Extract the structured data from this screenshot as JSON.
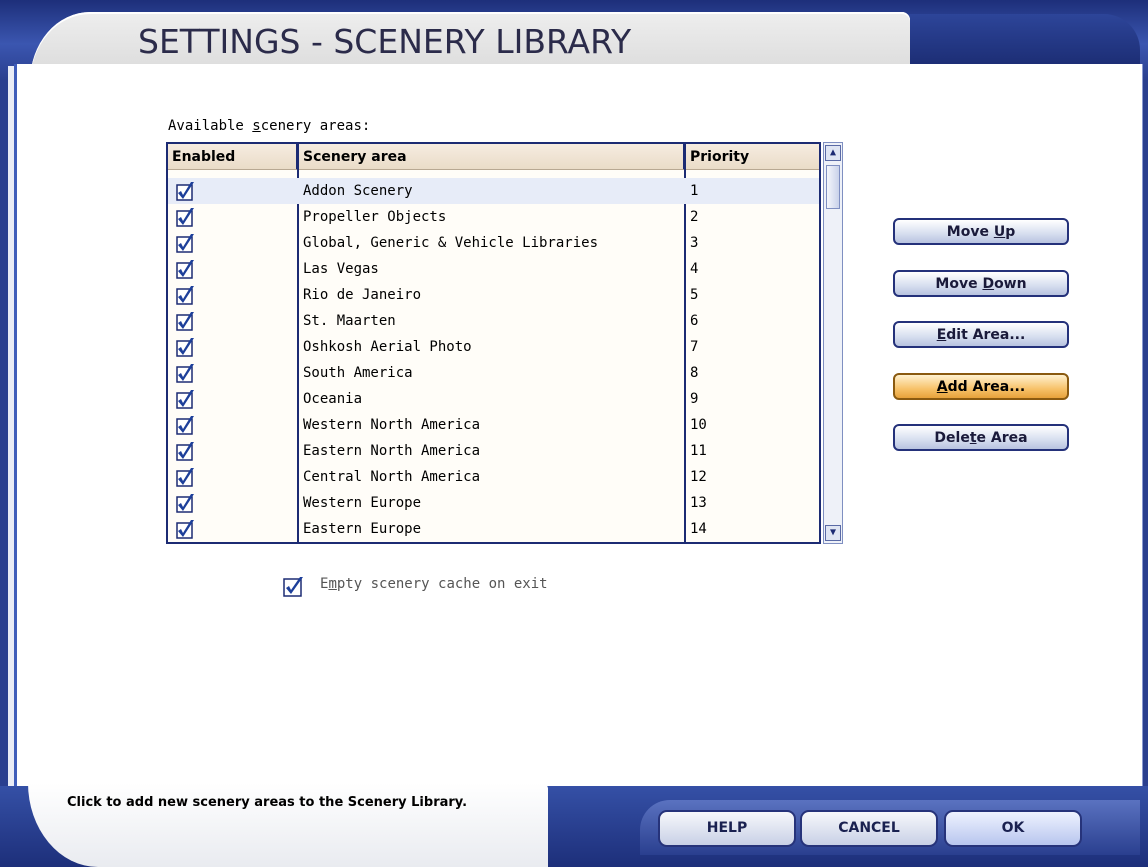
{
  "window": {
    "title": "SETTINGS - SCENERY LIBRARY"
  },
  "list": {
    "label_prefix": "Available ",
    "label_accel": "s",
    "label_suffix": "cenery areas:",
    "columns": {
      "enabled": "Enabled",
      "area": "Scenery area",
      "priority": "Priority"
    },
    "rows": [
      {
        "enabled": true,
        "area": "Addon Scenery",
        "priority": "1"
      },
      {
        "enabled": true,
        "area": "Propeller Objects",
        "priority": "2"
      },
      {
        "enabled": true,
        "area": "Global, Generic & Vehicle Libraries",
        "priority": "3"
      },
      {
        "enabled": true,
        "area": "Las Vegas",
        "priority": "4"
      },
      {
        "enabled": true,
        "area": "Rio de Janeiro",
        "priority": "5"
      },
      {
        "enabled": true,
        "area": "St. Maarten",
        "priority": "6"
      },
      {
        "enabled": true,
        "area": "Oshkosh Aerial Photo",
        "priority": "7"
      },
      {
        "enabled": true,
        "area": "South America",
        "priority": "8"
      },
      {
        "enabled": true,
        "area": "Oceania",
        "priority": "9"
      },
      {
        "enabled": true,
        "area": "Western North America",
        "priority": "10"
      },
      {
        "enabled": true,
        "area": "Eastern North America",
        "priority": "11"
      },
      {
        "enabled": true,
        "area": "Central North America",
        "priority": "12"
      },
      {
        "enabled": true,
        "area": "Western Europe",
        "priority": "13"
      },
      {
        "enabled": true,
        "area": "Eastern Europe",
        "priority": "14"
      }
    ],
    "selected_index": 0
  },
  "buttons": {
    "move_up": {
      "pre": "Move ",
      "accel": "U",
      "post": "p"
    },
    "move_down": {
      "pre": "Move ",
      "accel": "D",
      "post": "own"
    },
    "edit_area": {
      "pre": "",
      "accel": "E",
      "post": "dit Area..."
    },
    "add_area": {
      "pre": "",
      "accel": "A",
      "post": "dd Area..."
    },
    "delete_area": {
      "pre": "Dele",
      "accel": "t",
      "post": "e Area"
    }
  },
  "cache_option": {
    "checked": true,
    "pre": "E",
    "accel": "m",
    "post": "pty scenery cache on exit"
  },
  "hint": "Click to add new scenery areas to the Scenery Library.",
  "footer": {
    "help": "HELP",
    "cancel": "CANCEL",
    "ok": "OK"
  },
  "colors": {
    "frame_blue": "#2a3f8f",
    "border_navy": "#1c2b73",
    "active_button": "#f7c26a",
    "check_blue": "#1d3f9a"
  }
}
